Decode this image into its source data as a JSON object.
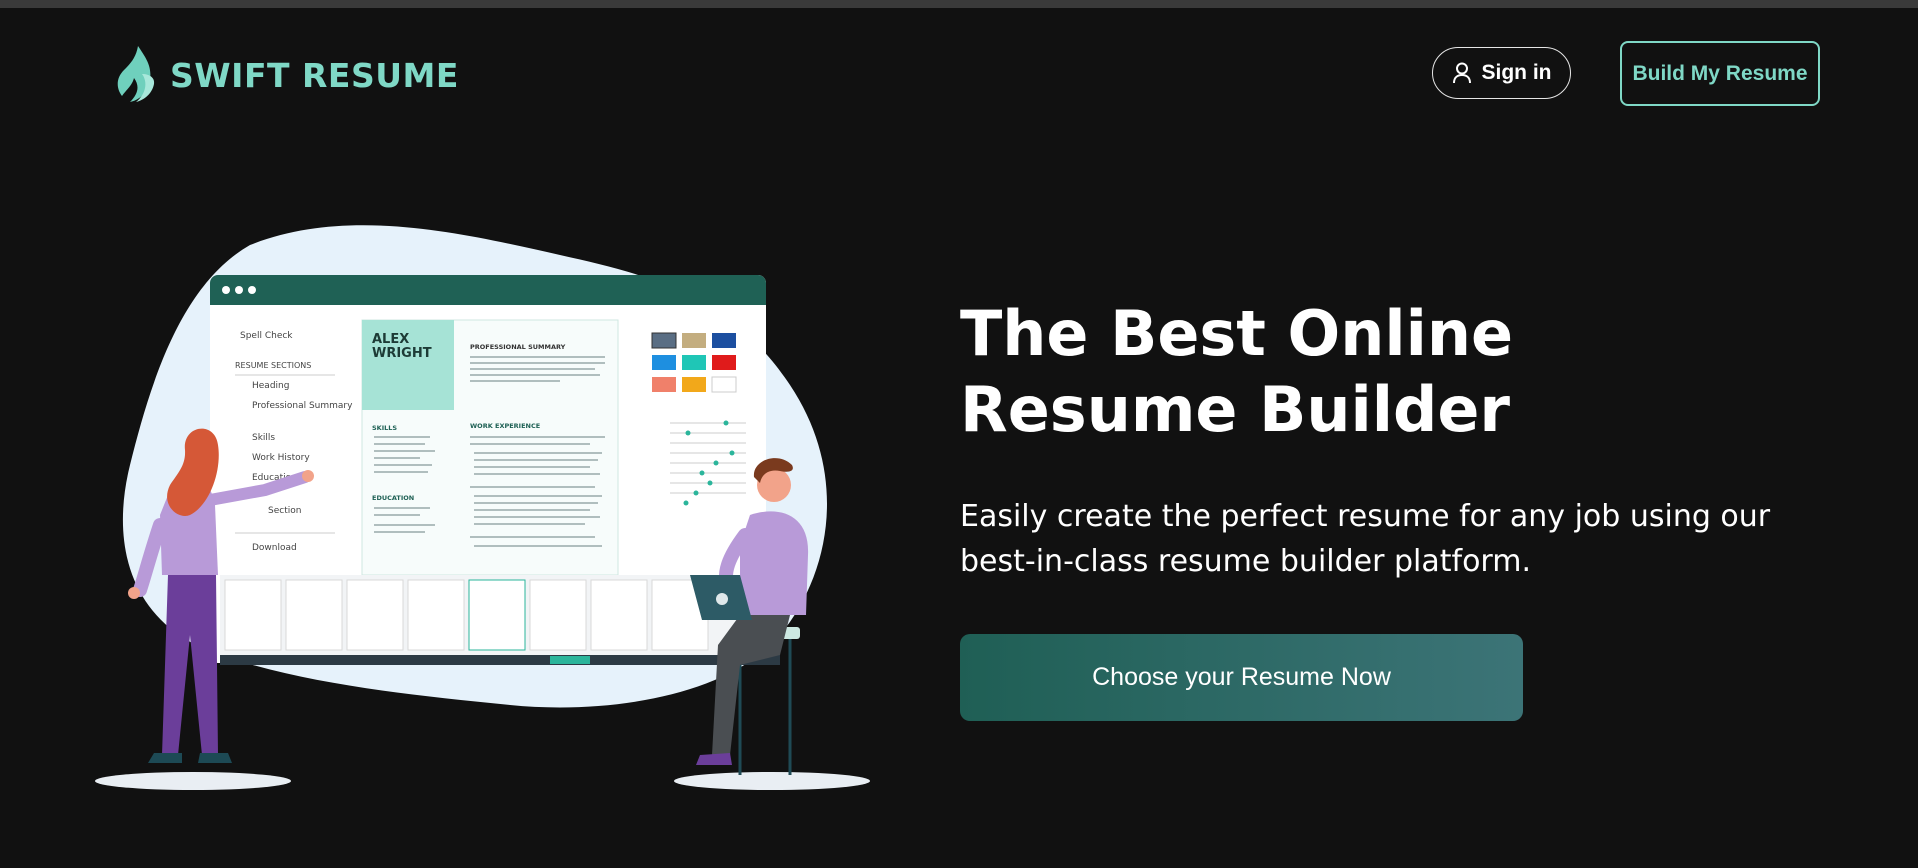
{
  "header": {
    "logo_text": "SWIFT RESUME",
    "signin_label": "Sign in",
    "build_label": "Build My Resume"
  },
  "hero": {
    "title_line1": "The Best Online",
    "title_line2": "Resume Builder",
    "subtitle": "Easily create the perfect resume for any job using our best-in-class resume builder platform.",
    "cta_label": "Choose your Resume Now"
  },
  "illustration": {
    "sidebar": {
      "spell_check": "Spell Check",
      "sections_label": "RESUME SECTIONS",
      "items": [
        "Heading",
        "Professional Summary",
        "Skills",
        "Work History",
        "Education",
        "Section"
      ],
      "download": "Download"
    },
    "resume": {
      "first_name": "ALEX",
      "last_name": "WRIGHT",
      "summary_heading": "PROFESSIONAL SUMMARY",
      "skills_heading": "SKILLS",
      "education_heading": "EDUCATION",
      "experience_heading": "WORK EXPERIENCE"
    }
  },
  "colors": {
    "accent": "#7fd8c6",
    "background": "#111111",
    "cta_start": "#1f5f55",
    "cta_end": "#3c7477"
  },
  "icons": {
    "logo": "flame-icon",
    "signin": "user-icon"
  }
}
